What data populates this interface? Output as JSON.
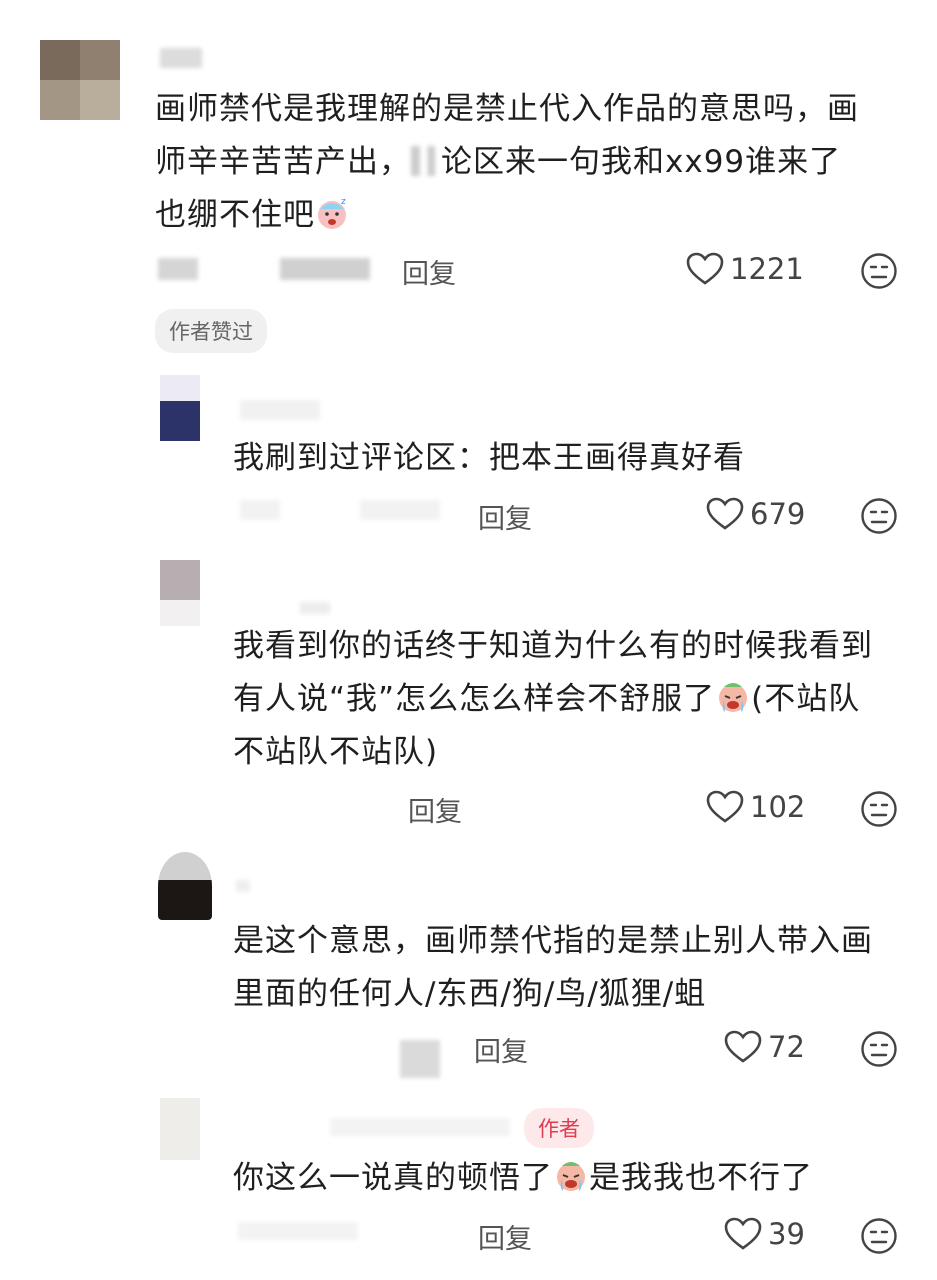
{
  "comments": [
    {
      "text_lines": [
        "画师禁代是我理解的是禁止代入作品的意思吗，画",
        "师辛辛苦苦产出，",
        "论区来一句我和xx99谁来了",
        "也绷不住吧"
      ],
      "reply_label": "回复",
      "likes": "1221",
      "author_liked_chip": "作者赞过"
    },
    {
      "text": "我刷到过评论区：把本王画得真好看",
      "reply_label": "回复",
      "likes": "679"
    },
    {
      "text_lines": [
        "我看到你的话终于知道为什么有的时候我看到",
        "有人说“我”怎么怎么样会不舒服了",
        "(不站队",
        "不站队不站队)"
      ],
      "reply_label": "回复",
      "likes": "102"
    },
    {
      "text_lines": [
        "是这个意思，画师禁代指的是禁止别人带入画",
        "里面的任何人/东西/狗/鸟/狐狸/蛆"
      ],
      "reply_label": "回复",
      "likes": "72"
    },
    {
      "author_tag": "作者",
      "text_parts": [
        "你这么一说真的顿悟了",
        "是我我也不行了"
      ],
      "reply_label": "回复",
      "likes": "39"
    }
  ],
  "icons": {
    "like": "heart-outline-icon",
    "reaction": "neutral-face-icon",
    "sleepy_emoji": "sleepy-face-emoji",
    "crying_emoji": "crying-face-emoji"
  },
  "colors": {
    "author_tag_bg": "#fde8ea",
    "author_tag_text": "#e23b4f",
    "chip_bg": "#f0f0f0"
  }
}
